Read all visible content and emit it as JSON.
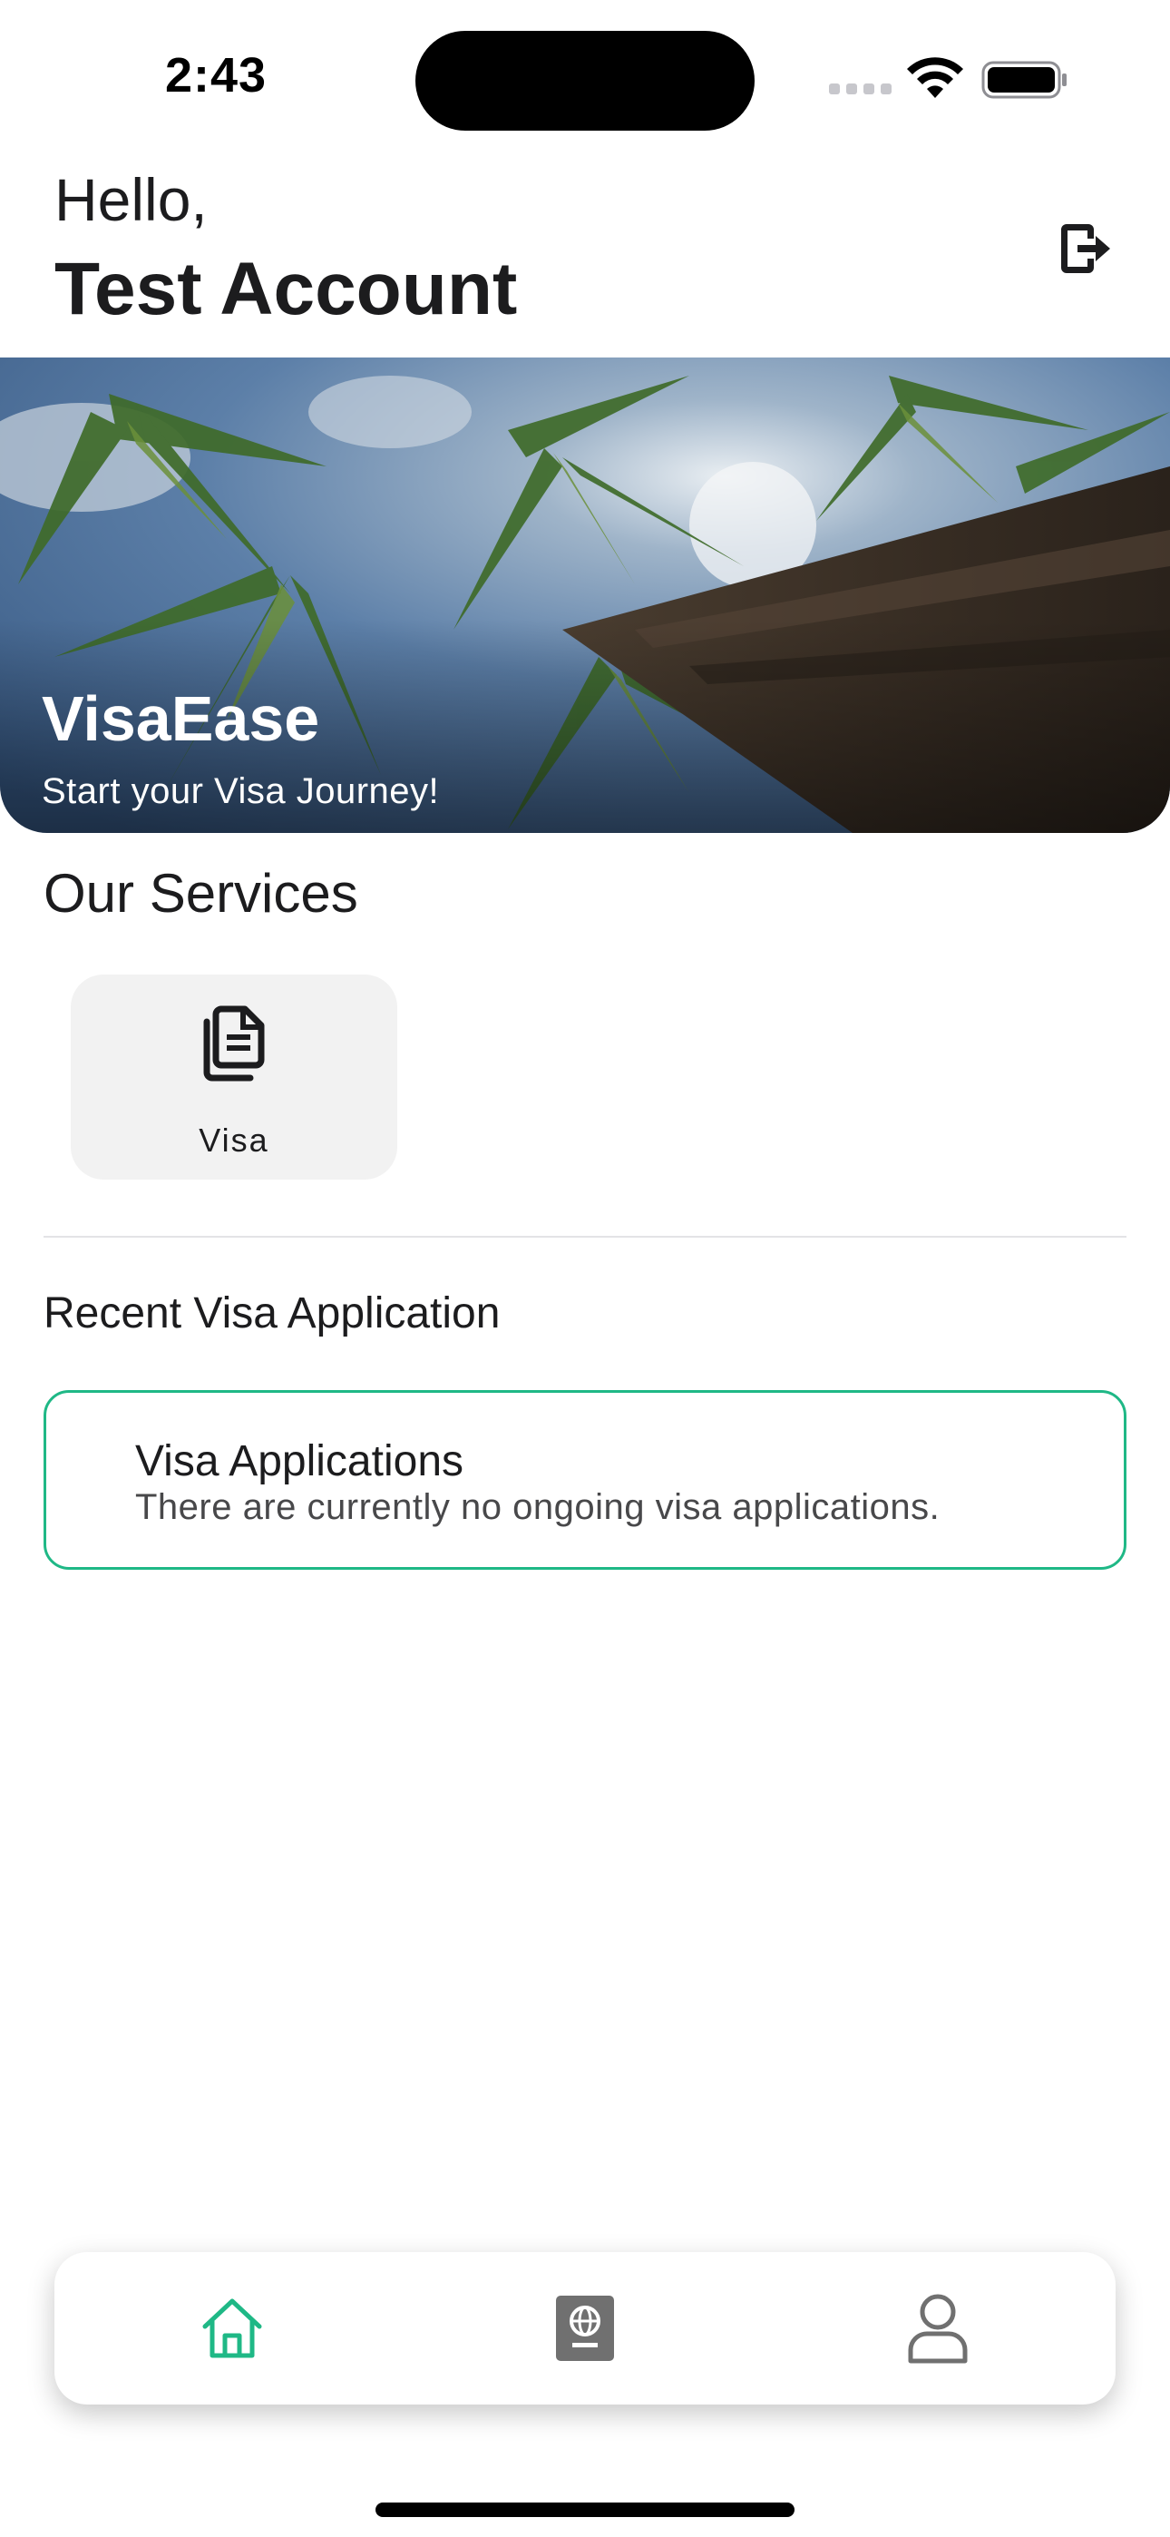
{
  "status_bar": {
    "time": "2:43"
  },
  "header": {
    "greeting": "Hello,",
    "user_name": "Test Account",
    "logout_icon": "logout-icon"
  },
  "hero": {
    "title": "VisaEase",
    "subtitle": "Start your Visa Journey!"
  },
  "services": {
    "title": "Our Services",
    "items": [
      {
        "label": "Visa",
        "icon": "document-icon"
      }
    ]
  },
  "recent": {
    "title": "Recent Visa Application",
    "card": {
      "title": "Visa Applications",
      "description": "There are currently no ongoing visa applications."
    }
  },
  "tab_bar": {
    "tabs": [
      {
        "icon": "home-icon",
        "active": true
      },
      {
        "icon": "passport-icon",
        "active": false
      },
      {
        "icon": "profile-icon",
        "active": false
      }
    ]
  },
  "colors": {
    "accent": "#1fb886",
    "card_bg": "#f2f2f2",
    "text_primary": "#1c1c1e",
    "icon_inactive": "#707070"
  }
}
